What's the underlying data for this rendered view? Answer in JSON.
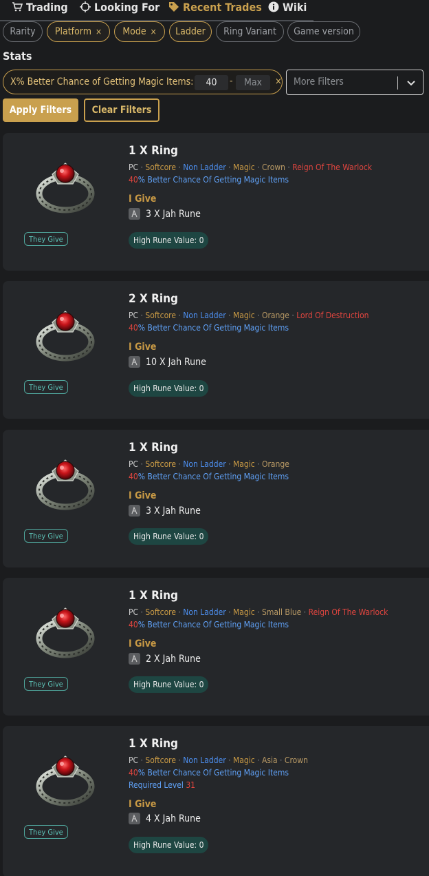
{
  "nav": {
    "tabs": [
      {
        "label": "Trading",
        "icon": "cart-icon"
      },
      {
        "label": "Looking For",
        "icon": "crosshair-icon"
      },
      {
        "label": "Recent Trades",
        "icon": "tag-icon"
      },
      {
        "label": "Wiki",
        "icon": "info-icon"
      }
    ]
  },
  "filters": {
    "chips": [
      {
        "label": "Rarity",
        "active": false
      },
      {
        "label": "Platform",
        "active": true,
        "removable": true
      },
      {
        "label": "Mode",
        "active": true,
        "removable": true
      },
      {
        "label": "Ladder",
        "active": true,
        "removable": false
      },
      {
        "label": "Ring Variant",
        "active": false
      },
      {
        "label": "Game version",
        "active": false
      }
    ],
    "remove_glyph": "×"
  },
  "stats": {
    "label": "Stats",
    "name": "X% Better Chance of Getting Magic Items:",
    "min": "40",
    "separator": "-",
    "max_placeholder": "Max",
    "remove": "×",
    "more_filters_placeholder": "More Filters"
  },
  "actions": {
    "apply": "Apply Filters",
    "clear": "Clear Filters"
  },
  "cards": [
    {
      "title": "1 X Ring",
      "platform": "PC",
      "mode": "Softcore",
      "ladder": "Non Ladder",
      "rarity": "Magic",
      "region": "",
      "variant": "Crown",
      "event": "Reign Of The Warlock",
      "prop_value": "40",
      "prop_text": "% Better Chance Of Getting Magic Items",
      "required_level_label": "",
      "required_level": "",
      "give_label": "I Give",
      "give_item": "3 X Jah Rune",
      "hrv": "High Rune Value: 0",
      "badge": "They Give"
    },
    {
      "title": "2 X Ring",
      "platform": "PC",
      "mode": "Softcore",
      "ladder": "Non Ladder",
      "rarity": "Magic",
      "region": "",
      "variant": "Orange",
      "event": "Lord Of Destruction",
      "prop_value": "40",
      "prop_text": "% Better Chance Of Getting Magic Items",
      "required_level_label": "",
      "required_level": "",
      "give_label": "I Give",
      "give_item": "10 X Jah Rune",
      "hrv": "High Rune Value: 0",
      "badge": "They Give"
    },
    {
      "title": "1 X Ring",
      "platform": "PC",
      "mode": "Softcore",
      "ladder": "Non Ladder",
      "rarity": "Magic",
      "region": "",
      "variant": "Orange",
      "event": "",
      "prop_value": "40",
      "prop_text": "% Better Chance Of Getting Magic Items",
      "required_level_label": "",
      "required_level": "",
      "give_label": "I Give",
      "give_item": "3 X Jah Rune",
      "hrv": "High Rune Value: 0",
      "badge": "They Give"
    },
    {
      "title": "1 X Ring",
      "platform": "PC",
      "mode": "Softcore",
      "ladder": "Non Ladder",
      "rarity": "Magic",
      "region": "",
      "variant": "Small Blue",
      "event": "Reign Of The Warlock",
      "prop_value": "40",
      "prop_text": "% Better Chance Of Getting Magic Items",
      "required_level_label": "",
      "required_level": "",
      "give_label": "I Give",
      "give_item": "2 X Jah Rune",
      "hrv": "High Rune Value: 0",
      "badge": "They Give"
    },
    {
      "title": "1 X Ring",
      "platform": "PC",
      "mode": "Softcore",
      "ladder": "Non Ladder",
      "rarity": "Magic",
      "region": "Asia",
      "variant": "Crown",
      "event": "",
      "prop_value": "40",
      "prop_text": "% Better Chance Of Getting Magic Items",
      "required_level_label": "Required Level ",
      "required_level": "31",
      "give_label": "I Give",
      "give_item": "4 X Jah Rune",
      "hrv": "High Rune Value: 0",
      "badge": "They Give"
    }
  ],
  "colors": {
    "accent": "#c9a04e",
    "teal": "#1e4642",
    "blue": "#4d8ff0",
    "red": "#e0453f"
  }
}
